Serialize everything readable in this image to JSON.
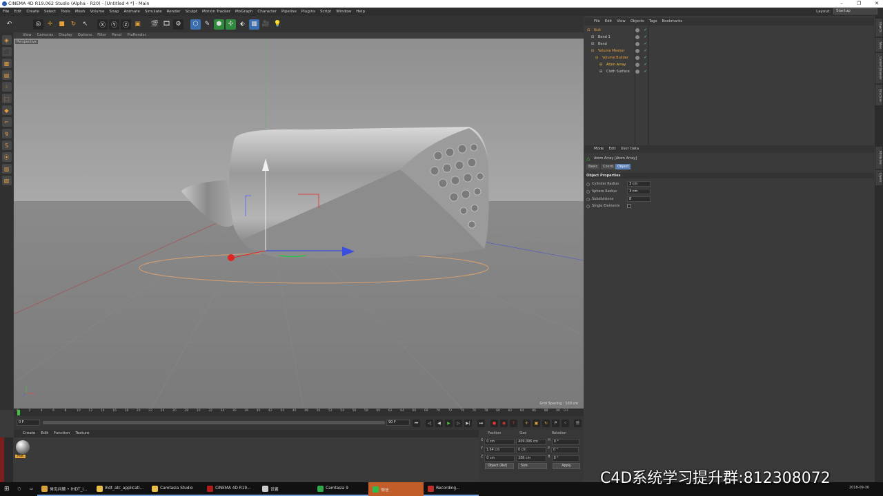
{
  "window": {
    "title": "CINEMA 4D R19.062 Studio (Alpha - R20) - [Untitled 4 *] - Main",
    "controls": [
      "–",
      "❐",
      "✕"
    ]
  },
  "menubar": {
    "items": [
      "File",
      "Edit",
      "Create",
      "Select",
      "Tools",
      "Mesh",
      "Volume",
      "Snap",
      "Animate",
      "Simulate",
      "Render",
      "Sculpt",
      "Motion Tracker",
      "MoGraph",
      "Character",
      "Pipeline",
      "Plugins",
      "Script",
      "Window",
      "Help"
    ],
    "layout_label": "Layout:",
    "layout_value": "Startup"
  },
  "viewport": {
    "menu": [
      "View",
      "Cameras",
      "Display",
      "Options",
      "Filter",
      "Panel",
      "ProRender"
    ],
    "camera_label": "Perspective",
    "grid_spacing": "Grid Spacing : 100 cm"
  },
  "timeline": {
    "ticks": [
      "0",
      "2",
      "4",
      "6",
      "8",
      "10",
      "12",
      "14",
      "16",
      "18",
      "20",
      "22",
      "24",
      "26",
      "28",
      "30",
      "32",
      "34",
      "36",
      "38",
      "40",
      "42",
      "44",
      "46",
      "48",
      "50",
      "52",
      "54",
      "56",
      "58",
      "60",
      "62",
      "64",
      "66",
      "68",
      "70",
      "72",
      "74",
      "76",
      "78",
      "80",
      "82",
      "84",
      "86",
      "88",
      "90"
    ],
    "end_frame_label": "0 F",
    "current_frame": "0 F",
    "scrub_end": "90 F",
    "max_frame": "90 F"
  },
  "material_manager": {
    "menu": [
      "Create",
      "Edit",
      "Function",
      "Texture"
    ],
    "material_name": "Mat"
  },
  "coordinates": {
    "headers": [
      "Position",
      "Size",
      "Rotation"
    ],
    "rows": [
      {
        "axis": "X",
        "pos": "0 cm",
        "size": "409.096 cm",
        "rot_axis": "H",
        "rot": "0 °"
      },
      {
        "axis": "Y",
        "pos": "1.64 cm",
        "size": "0 cm",
        "rot_axis": "P",
        "rot": "0 °"
      },
      {
        "axis": "Z",
        "pos": "0 cm",
        "size": "206 cm",
        "rot_axis": "B",
        "rot": "0 °"
      }
    ],
    "mode_select": "Object (Rel)",
    "size_select": "Size",
    "apply_label": "Apply"
  },
  "object_manager": {
    "menu": [
      "File",
      "Edit",
      "View",
      "Objects",
      "Tags",
      "Bookmarks"
    ],
    "objects": [
      {
        "name": "Null",
        "indent": 0,
        "color": "#e8a040"
      },
      {
        "name": "Bend 1",
        "indent": 1,
        "color": "#cfcfcf"
      },
      {
        "name": "Bend",
        "indent": 1,
        "color": "#cfcfcf"
      },
      {
        "name": "Volume Mesher",
        "indent": 1,
        "color": "#e8a040"
      },
      {
        "name": "Volume Builder",
        "indent": 2,
        "color": "#e8a040"
      },
      {
        "name": "Atom Array",
        "indent": 3,
        "color": "#f0c040"
      },
      {
        "name": "Cloth Surface",
        "indent": 3,
        "color": "#cfcfcf"
      }
    ]
  },
  "attributes": {
    "menu": [
      "Mode",
      "Edit",
      "User Data"
    ],
    "title": "Atom Array [Atom Array]",
    "tabs": [
      "Basic",
      "Coord.",
      "Object"
    ],
    "active_tab": "Object",
    "section": "Object Properties",
    "properties": [
      {
        "label": "Cylinder Radius",
        "value": "3 cm"
      },
      {
        "label": "Sphere Radius",
        "value": "3 cm"
      },
      {
        "label": "Subdivisions",
        "value": "8"
      },
      {
        "label": "Single Elements",
        "value": ""
      }
    ]
  },
  "right_tabs": [
    "Objects",
    "Takes",
    "Content Browser",
    "Structure",
    "Attributes",
    "Layers"
  ],
  "taskbar": {
    "items": [
      {
        "label": "常见问题 • IHDT_i...",
        "color": "#d9a13a"
      },
      {
        "label": "ihdt_atc_applicati...",
        "color": "#e8c049"
      },
      {
        "label": "Camtasia Studio",
        "color": "#e8c049"
      },
      {
        "label": "CINEMA 4D R19...",
        "color": "#b01c1c"
      },
      {
        "label": "设置",
        "color": "#cccccc"
      },
      {
        "label": "Camtasia 9",
        "color": "#2fa84a"
      },
      {
        "label": "微信",
        "color": "#2dbb4a"
      },
      {
        "label": "Recording...",
        "color": "#c0302a"
      }
    ],
    "clock": "2018-09-30"
  },
  "watermark": "C4D系统学习提升群:812308072",
  "colors": {
    "accent_orange": "#e5a23b",
    "axis_red": "#e02424",
    "axis_green": "#2fbf4a",
    "axis_blue": "#3a4fe0"
  }
}
